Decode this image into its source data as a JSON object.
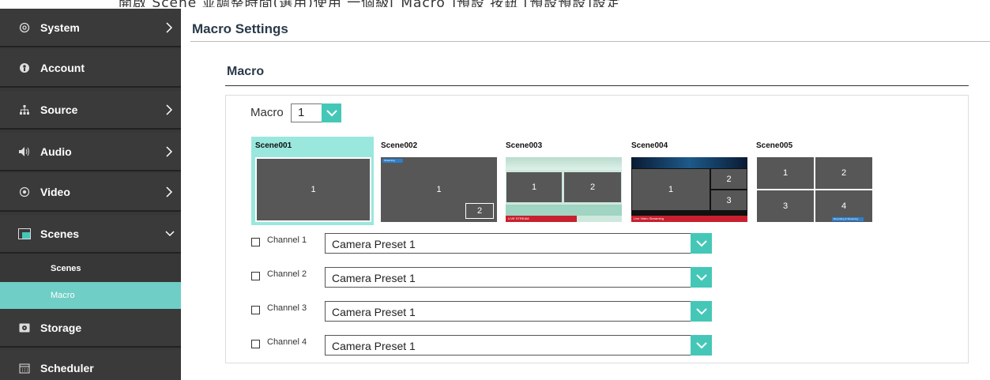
{
  "top_caption": "開啟 Scene 並調整時間(選用)使用 一個級[ Macro ]預設 按鈕 [預設預設]設定",
  "sidebar": {
    "items": [
      {
        "label": "System",
        "icon": "gear-icon"
      },
      {
        "label": "Account",
        "icon": "user-icon"
      },
      {
        "label": "Source",
        "icon": "sitemap-icon"
      },
      {
        "label": "Audio",
        "icon": "speaker-icon"
      },
      {
        "label": "Video",
        "icon": "radio-dot-icon"
      },
      {
        "label": "Scenes",
        "icon": "scenes-icon"
      },
      {
        "label": "Storage",
        "icon": "storage-icon"
      },
      {
        "label": "Scheduler",
        "icon": "calendar-icon"
      }
    ],
    "sub_items": [
      {
        "label": "Scenes"
      },
      {
        "label": "Macro"
      }
    ]
  },
  "page": {
    "title": "Macro Settings",
    "section": "Macro"
  },
  "macro": {
    "label": "Macro",
    "value": "1"
  },
  "scenes": [
    {
      "name": "Scene001",
      "cells": [
        "1"
      ],
      "selected": true
    },
    {
      "name": "Scene002",
      "cells": [
        "1",
        "2"
      ],
      "overlay": "Streaming"
    },
    {
      "name": "Scene003",
      "cells": [
        "1",
        "2"
      ],
      "banner": "LIVE STREAM"
    },
    {
      "name": "Scene004",
      "cells": [
        "1",
        "2",
        "3"
      ],
      "banner": "Live Video Streaming"
    },
    {
      "name": "Scene005",
      "cells": [
        "1",
        "2",
        "3",
        "4"
      ],
      "banner": "Recording & Streaming"
    }
  ],
  "channels": [
    {
      "label": "Channel 1",
      "value": "Camera Preset 1"
    },
    {
      "label": "Channel 2",
      "value": "Camera Preset 1"
    },
    {
      "label": "Channel 3",
      "value": "Camera Preset 1"
    },
    {
      "label": "Channel 4",
      "value": "Camera Preset 1"
    }
  ],
  "colors": {
    "accent": "#45c7b7",
    "active_sub": "#6fcec6",
    "sidebar_bg": "#3a3a3a",
    "selected_scene": "#9ae7de"
  }
}
